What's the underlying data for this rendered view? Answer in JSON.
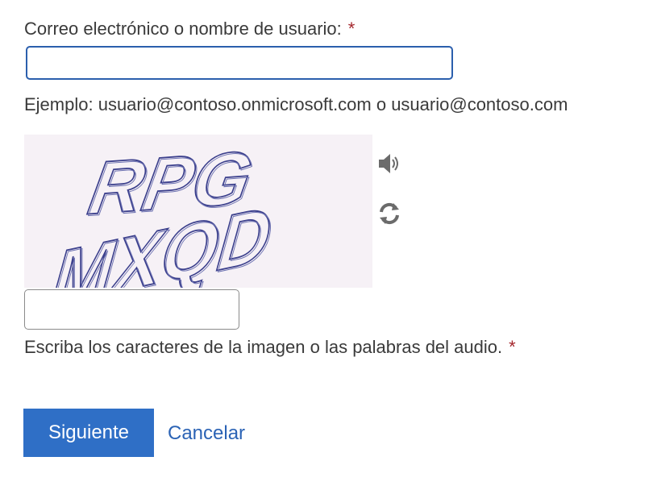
{
  "form": {
    "email_label": "Correo electrónico o nombre de usuario:",
    "required_marker": "*",
    "email_value": "",
    "example_text": "Ejemplo: usuario@contoso.onmicrosoft.com o usuario@contoso.com",
    "captcha": {
      "image_text_line1": "RPG",
      "image_text_line2": "MXQD",
      "audio_icon": "speaker-icon",
      "refresh_icon": "refresh-icon",
      "input_value": "",
      "instruction": "Escriba los caracteres de la imagen o las palabras del audio."
    },
    "next_button_label": "Siguiente",
    "cancel_link_label": "Cancelar"
  },
  "colors": {
    "primary_button": "#2f6fc6",
    "link": "#2b63b5",
    "required": "#a4262c",
    "focused_border": "#2b5fad"
  }
}
